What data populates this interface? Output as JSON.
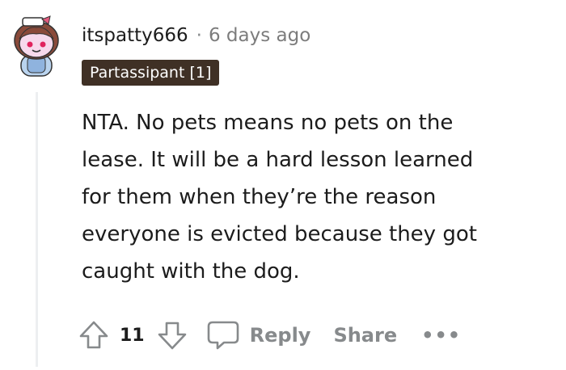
{
  "comment": {
    "username": "itspatty666",
    "separator": "·",
    "timestamp": "6 days ago",
    "flair": "Partassipant [1]",
    "body_lines": [
      "NTA. No pets means no pets on the",
      "lease. It will be a hard lesson learned",
      "for them when they’re the reason",
      "everyone is evicted because they got",
      "caught with the dog."
    ]
  },
  "actions": {
    "score": "11",
    "reply_label": "Reply",
    "share_label": "Share",
    "more_label": "•••"
  },
  "icons": {
    "upvote": "upvote-arrow-icon",
    "downvote": "downvote-arrow-icon",
    "reply": "speech-bubble-icon",
    "avatar": "snoo-avatar"
  },
  "colors": {
    "flair_background": "#3f3025",
    "flair_text": "#ffffff",
    "muted": "#878a8c",
    "thread_line": "#edeff1"
  }
}
